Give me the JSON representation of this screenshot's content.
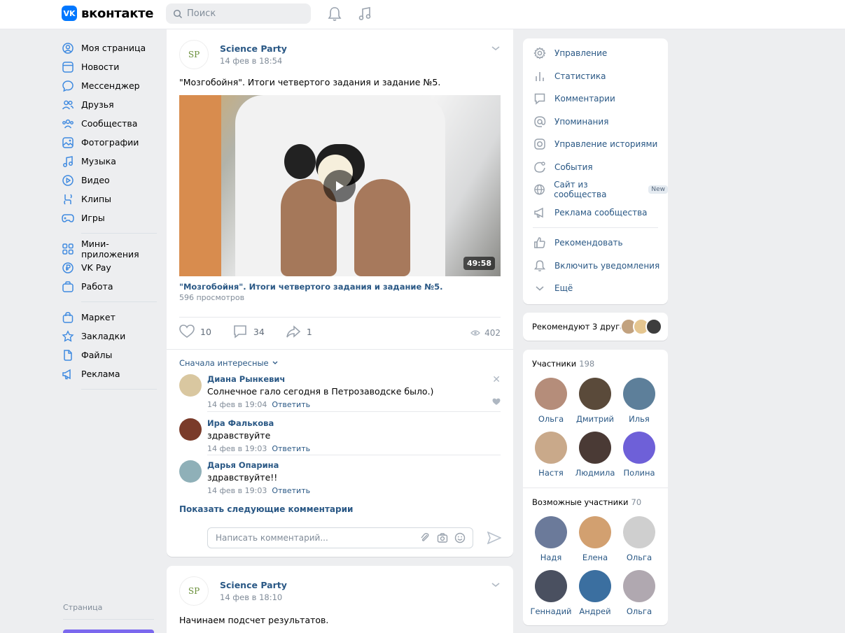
{
  "header": {
    "logo_mark": "VK",
    "logo_text": "вконтакте",
    "search_placeholder": "Поиск"
  },
  "nav": {
    "group1": [
      {
        "label": "Моя страница",
        "icon": "user-circle-icon"
      },
      {
        "label": "Новости",
        "icon": "news-icon"
      },
      {
        "label": "Мессенджер",
        "icon": "message-icon"
      },
      {
        "label": "Друзья",
        "icon": "friends-icon"
      },
      {
        "label": "Сообщества",
        "icon": "communities-icon"
      },
      {
        "label": "Фотографии",
        "icon": "photo-icon"
      },
      {
        "label": "Музыка",
        "icon": "music-icon"
      },
      {
        "label": "Видео",
        "icon": "video-icon"
      },
      {
        "label": "Клипы",
        "icon": "clips-icon"
      },
      {
        "label": "Игры",
        "icon": "games-icon"
      }
    ],
    "group2": [
      {
        "label": "Мини-приложения",
        "icon": "apps-icon"
      },
      {
        "label": "VK Pay",
        "icon": "vkpay-icon"
      },
      {
        "label": "Работа",
        "icon": "work-icon"
      }
    ],
    "group3": [
      {
        "label": "Маркет",
        "icon": "market-icon"
      },
      {
        "label": "Закладки",
        "icon": "bookmark-icon"
      },
      {
        "label": "Файлы",
        "icon": "file-icon"
      },
      {
        "label": "Реклама",
        "icon": "ads-icon"
      }
    ],
    "footer_label": "Страница"
  },
  "post1": {
    "author": "Science Party",
    "avatar_text": "SP",
    "date": "14 фев в 18:54",
    "text": "\"Мозгобойня\". Итоги четвертого задания и задание №5.",
    "video_duration": "49:58",
    "video_title": "\"Мозгобойня\". Итоги четвертого задания и задание №5.",
    "video_views": "596 просмотров",
    "likes": "10",
    "comments": "34",
    "shares": "1",
    "views": "402",
    "sort_label": "Сначала интересные",
    "comment_list": [
      {
        "name": "Диана Рынкевич",
        "text": "Солнечное гало сегодня в Петрозаводске было.)",
        "date": "14 фев в 19:04",
        "reply": "Ответить",
        "avatar_color": "#d9c7a0"
      },
      {
        "name": "Ира Фалькова",
        "text": "здравствуйте",
        "date": "14 фев в 19:03",
        "reply": "Ответить",
        "avatar_color": "#7a3b2a"
      },
      {
        "name": "Дарья Опарина",
        "text": "здравствуйте!!",
        "date": "14 фев в 19:03",
        "reply": "Ответить",
        "avatar_color": "#8fb0b8"
      }
    ],
    "show_more": "Показать следующие комментарии",
    "comment_placeholder": "Написать комментарий..."
  },
  "post2": {
    "author": "Science Party",
    "avatar_text": "SP",
    "date": "14 фев в 18:10",
    "text": "Начинаем подсчет результатов."
  },
  "side": {
    "menu1": [
      {
        "label": "Управление",
        "icon": "gear-icon"
      },
      {
        "label": "Статистика",
        "icon": "stats-icon"
      },
      {
        "label": "Комментарии",
        "icon": "comment-icon"
      },
      {
        "label": "Упоминания",
        "icon": "mention-icon"
      },
      {
        "label": "Управление историями",
        "icon": "stories-icon"
      },
      {
        "label": "События",
        "icon": "events-icon"
      },
      {
        "label": "Сайт из сообщества",
        "icon": "globe-icon",
        "badge": "New"
      },
      {
        "label": "Реклама сообщества",
        "icon": "megaphone-icon"
      }
    ],
    "menu2": [
      {
        "label": "Рекомендовать",
        "icon": "thumbs-up-icon"
      },
      {
        "label": "Включить уведомления",
        "icon": "bell-icon"
      },
      {
        "label": "Ещё",
        "icon": "chevron-down-icon"
      }
    ],
    "recommend_text": "Рекомендуют 3 друга",
    "members_title": "Участники",
    "members_count": "198",
    "members": [
      {
        "name": "Ольга",
        "color": "#b58d7a"
      },
      {
        "name": "Дмитрий",
        "color": "#5a4a3a"
      },
      {
        "name": "Илья",
        "color": "#5d7f9a"
      },
      {
        "name": "Настя",
        "color": "#c9a98a"
      },
      {
        "name": "Людмила",
        "color": "#4a3a35"
      },
      {
        "name": "Полина",
        "color": "#6e60d8"
      }
    ],
    "possible_title": "Возможные участники",
    "possible_count": "70",
    "possible": [
      {
        "name": "Надя",
        "color": "#6b7a9a"
      },
      {
        "name": "Елена",
        "color": "#d2a070"
      },
      {
        "name": "Ольга",
        "color": "#cfcfcf"
      },
      {
        "name": "Геннадий",
        "color": "#4a5060"
      },
      {
        "name": "Андрей",
        "color": "#3b6fa0"
      },
      {
        "name": "Ольга",
        "color": "#b0a8b0"
      }
    ]
  },
  "colors": {
    "accent": "#2a5885",
    "brand": "#0077ff",
    "bg": "#edeef0"
  }
}
